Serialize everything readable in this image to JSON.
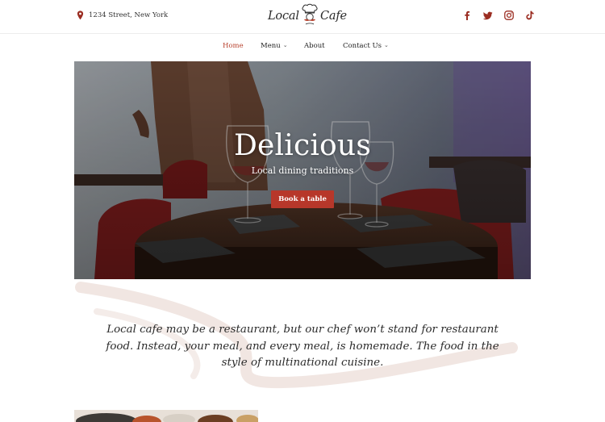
{
  "header": {
    "address": "1234 Street, New York",
    "logo": {
      "word1": "Local",
      "word2": "Cafe"
    },
    "social": [
      {
        "icon": "facebook-icon"
      },
      {
        "icon": "twitter-icon"
      },
      {
        "icon": "instagram-icon"
      },
      {
        "icon": "tiktok-icon"
      }
    ]
  },
  "nav": {
    "items": [
      {
        "label": "Home",
        "active": true,
        "dropdown": false
      },
      {
        "label": "Menu",
        "active": false,
        "dropdown": true
      },
      {
        "label": "About",
        "active": false,
        "dropdown": false
      },
      {
        "label": "Contact Us",
        "active": false,
        "dropdown": true
      }
    ]
  },
  "hero": {
    "title": "Delicious",
    "subtitle": "Local dining traditions",
    "button_label": "Book a table"
  },
  "intro": {
    "text": "Local cafe may be a restaurant, but our chef won’t stand for restaurant food. Instead, your meal, and every meal, is homemade. The food in the style of multinational cuisine."
  },
  "colors": {
    "accent": "#b8432f",
    "button": "#b7372a",
    "icon": "#9b2d22"
  }
}
